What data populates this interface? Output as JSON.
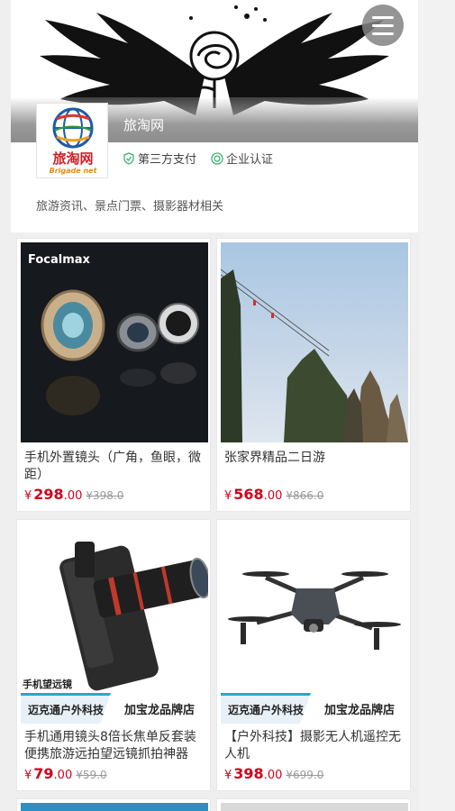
{
  "store": {
    "name": "旅淘网",
    "logo_cn": "旅淘网",
    "logo_en": "Brigade net",
    "badges": [
      {
        "label": "第三方支付",
        "icon": "shield-check-icon"
      },
      {
        "label": "企业认证",
        "icon": "verified-circle-icon"
      }
    ],
    "tags": "旅游资讯、景点门票、摄影器材相关"
  },
  "menu": {
    "icon": "hamburger-menu-icon"
  },
  "colors": {
    "price": "#d0021b",
    "accent": "#2aa7c9",
    "badge_green": "#3cb371"
  },
  "products": [
    {
      "title": "手机外置镜头（广角，鱼眼，微距）",
      "currency": "¥",
      "price_int": "298",
      "price_dec": ".00",
      "old_price": "¥398.0",
      "image_caption": "Focalmax",
      "image": "phone-lens-kit-image"
    },
    {
      "title": "张家界精品二日游",
      "currency": "¥",
      "price_int": "568",
      "price_dec": ".00",
      "old_price": "¥866.0",
      "image": "zhangjiajie-mountain-cable-car-image"
    },
    {
      "title": "手机通用镜头8倍长焦单反套装便携旅游远拍望远镜抓拍神器",
      "currency": "¥",
      "price_int": "79",
      "price_dec": ".00",
      "old_price": "¥59.0",
      "image": "phone-telephoto-lens-image",
      "image_caption": "手机望远镜",
      "ad_left": "迈克通户外科技",
      "ad_right": "加宝龙品牌店"
    },
    {
      "title": "【户外科技】摄影无人机遥控无人机",
      "currency": "¥",
      "price_int": "398",
      "price_dec": ".00",
      "old_price": "¥699.0",
      "image": "drone-image",
      "ad_left": "迈克通户外科技",
      "ad_right": "加宝龙品牌店"
    }
  ]
}
